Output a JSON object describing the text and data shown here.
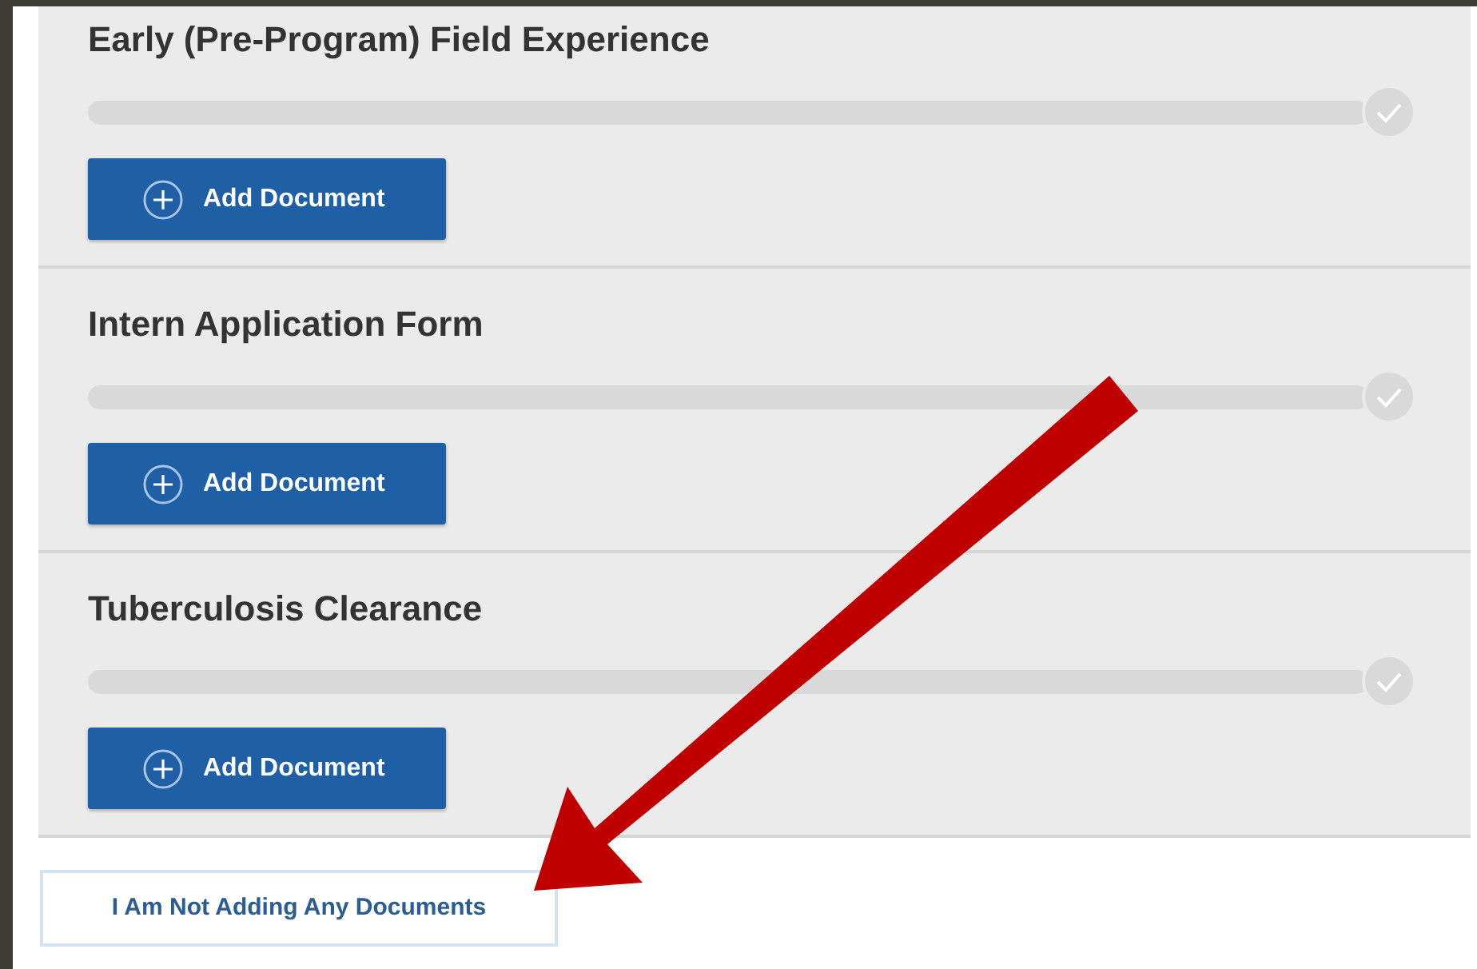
{
  "sections": [
    {
      "title": "Early (Pre-Program) Field Experience",
      "progress": {
        "level": 0,
        "complete": false
      },
      "button": "Add Document"
    },
    {
      "title": "Intern Application Form",
      "progress": {
        "level": 0,
        "complete": false
      },
      "button": "Add Document"
    },
    {
      "title": "Tuberculosis Clearance",
      "progress": {
        "level": 0,
        "complete": false
      },
      "button": "Add Document"
    }
  ],
  "footer_button": "I Am Not Adding Any Documents",
  "annotation": {
    "kind": "arrow"
  }
}
